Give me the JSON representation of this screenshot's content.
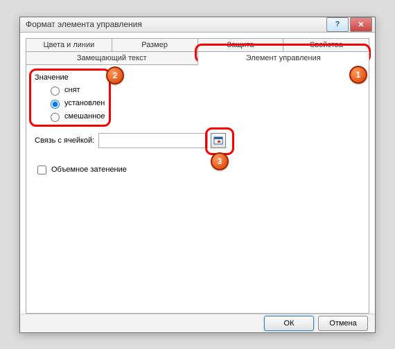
{
  "title": "Формат элемента управления",
  "tabs": {
    "colors_lines": "Цвета и линии",
    "size": "Размер",
    "protection": "Защита",
    "properties": "Свойства",
    "alt_text": "Замещающий текст",
    "control": "Элемент управления"
  },
  "group": {
    "value_label": "Значение",
    "radio_unchecked": "снят",
    "radio_checked": "установлен",
    "radio_mixed": "смешанное"
  },
  "cell_link": {
    "label": "Связь с ячейкой:",
    "value": ""
  },
  "shading_3d": "Объемное затенение",
  "buttons": {
    "ok": "ОК",
    "cancel": "Отмена"
  },
  "badges": {
    "b1": "1",
    "b2": "2",
    "b3": "3"
  }
}
